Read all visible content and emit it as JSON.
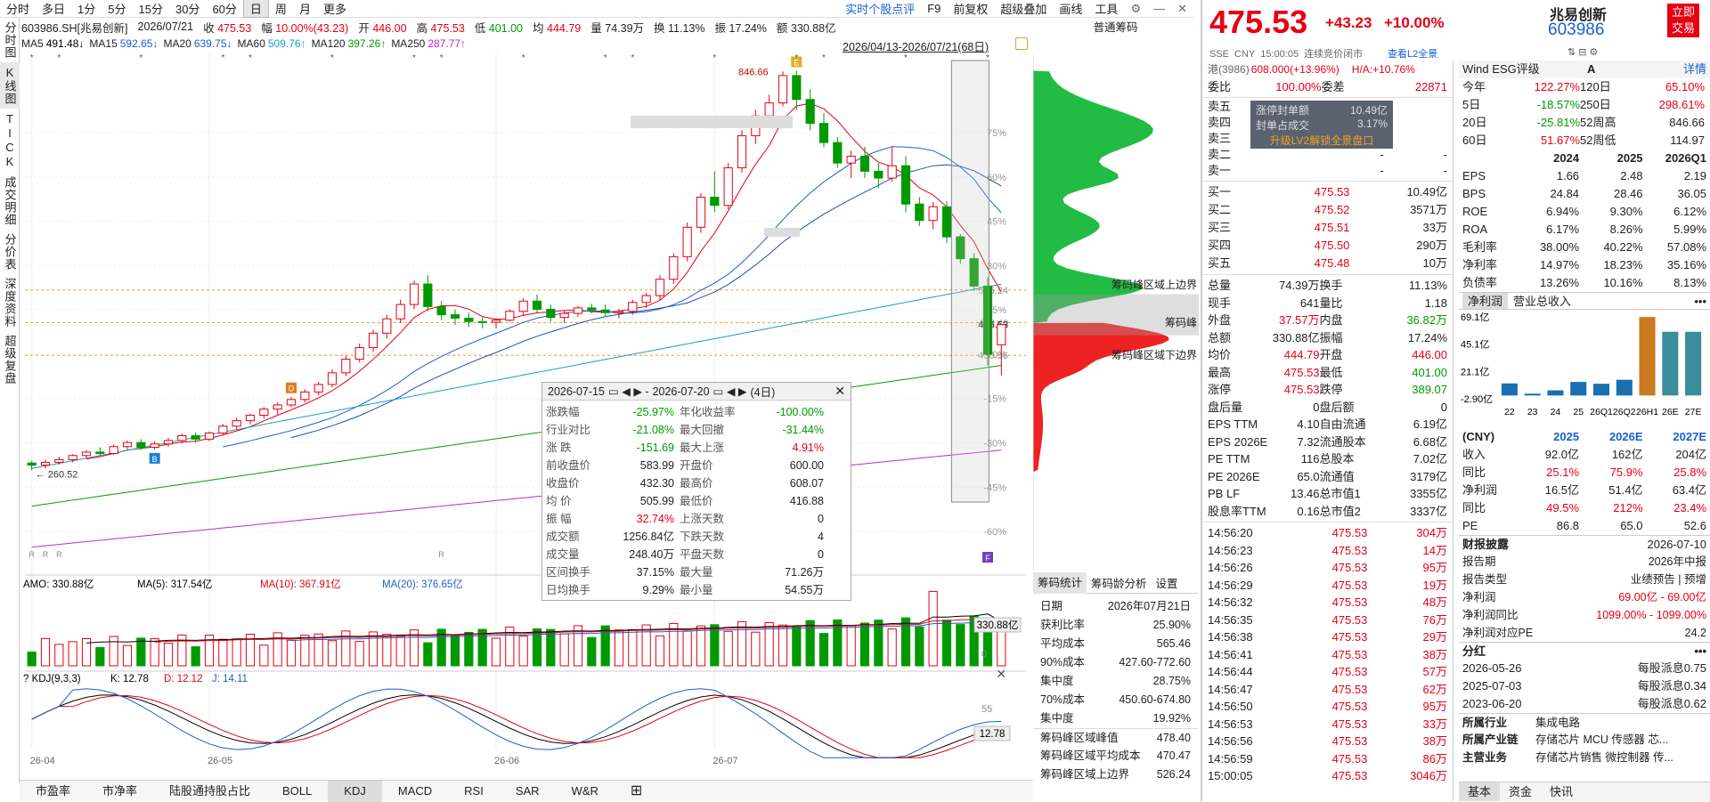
{
  "toolbar": {
    "periods": [
      "分时",
      "多日",
      "1分",
      "5分",
      "15分",
      "30分",
      "60分",
      "日",
      "周",
      "月",
      "更多"
    ],
    "selected": "日",
    "right_items": [
      "实时个股点评",
      "F9",
      "前复权",
      "超级叠加",
      "画线",
      "工具"
    ],
    "icons": [
      "gear-icon",
      "minus-icon",
      "close-icon"
    ]
  },
  "info": {
    "code": "603986.SH[兆易创新]",
    "date": "2026/07/21",
    "close_label": "收",
    "close": "475.53",
    "chg_label": "幅",
    "chg": "10.00%(43.23)",
    "open_label": "开",
    "open": "446.00",
    "high_label": "高",
    "high": "475.53",
    "low_label": "低",
    "low": "401.00",
    "avg_label": "均",
    "avg": "444.79",
    "vol_label": "量",
    "vol": "74.39万",
    "turn_label": "换",
    "turn": "11.13%",
    "amp_label": "振",
    "amp": "17.24%",
    "amt_label": "额",
    "amt": "330.88亿"
  },
  "ma": [
    {
      "name": "MA5",
      "value": "491.48↓",
      "color": "#000000"
    },
    {
      "name": "MA15",
      "value": "592.65↓",
      "color": "#1a5fd0"
    },
    {
      "name": "MA20",
      "value": "639.75↓",
      "color": "#1a5fd0"
    },
    {
      "name": "MA60",
      "value": "509.76↑",
      "color": "#19a0c8"
    },
    {
      "name": "MA120",
      "value": "397.26↑",
      "color": "#009a00"
    },
    {
      "name": "MA250",
      "value": "287.77↑",
      "color": "#cc22cc"
    }
  ],
  "range_text": "2026/04/13-2026/07/21(68日)",
  "vtabs": [
    "分时图",
    "K线图",
    "TICK",
    "成交明细",
    "分价表",
    "深度资料",
    "超级复盘"
  ],
  "kchart": {
    "pct_ticks": [
      "75%",
      "60%",
      "45%",
      "30%",
      "15%",
      "0%",
      "-15%",
      "-30%",
      "-45%",
      "-60%"
    ],
    "high_marker": "846.66",
    "low_marker": "260.52",
    "price_marks": [
      "526.24",
      "478.40",
      "475.53",
      "430.56"
    ],
    "date_ticks": [
      "26-04",
      "26-05",
      "26-06",
      "26-07"
    ],
    "event_badges": [
      "D",
      "E",
      "F",
      "B"
    ],
    "rights_marker": "R"
  },
  "amo": {
    "label": "AMO: 330.88亿",
    "ma5": "MA(5): 317.54亿",
    "ma10": "MA(10): 367.91亿",
    "ma20": "MA(20): 376.65亿",
    "last": "330.88亿",
    "zero": "0"
  },
  "kdj": {
    "label": "KDJ(9,3,3)",
    "k": "K: 12.78",
    "d": "D: 12.12",
    "j": "J: 14.11",
    "tick": "55",
    "last": "12.78"
  },
  "bottom_tabs": [
    "市盈率",
    "市净率",
    "陆股通持股占比",
    "BOLL",
    "KDJ",
    "MACD",
    "RSI",
    "SAR",
    "W&R"
  ],
  "bottom_active": "KDJ",
  "popup": {
    "from": "2026-07-15",
    "to": "2026-07-20",
    "days": "(4日)",
    "rows": [
      [
        "涨跌幅",
        "-25.97%",
        "年化收益率",
        "-100.00%"
      ],
      [
        "行业对比",
        "-21.08%",
        "最大回撤",
        "-31.44%"
      ],
      [
        "涨 跌",
        "-151.69",
        "最大上涨",
        "4.91%"
      ],
      [
        "前收盘价",
        "583.99",
        "开盘价",
        "600.00"
      ],
      [
        "收盘价",
        "432.30",
        "最高价",
        "608.07"
      ],
      [
        "均 价",
        "505.99",
        "最低价",
        "416.88"
      ],
      [
        "振 幅",
        "32.74%",
        "上涨天数",
        "0"
      ],
      [
        "成交额",
        "1256.84亿",
        "下跌天数",
        "4"
      ],
      [
        "成交量",
        "248.40万",
        "平盘天数",
        "0"
      ],
      [
        "区间换手",
        "37.15%",
        "最大量",
        "71.26万"
      ],
      [
        "日均换手",
        "9.29%",
        "最小量",
        "54.55万"
      ]
    ]
  },
  "chips": {
    "title": "普通筹码",
    "labels": [
      "筹码峰区域上边界",
      "筹码峰",
      "筹码峰区域下边界"
    ],
    "tabs": [
      "筹码统计",
      "筹码龄分析",
      "设置"
    ],
    "stats": [
      [
        "日期",
        "2026年07月21日"
      ],
      [
        "获利比率",
        "25.90%"
      ],
      [
        "平均成本",
        "565.46"
      ],
      [
        "90%成本",
        "427.60-772.60"
      ],
      [
        "集中度",
        "28.75%"
      ],
      [
        "70%成本",
        "450.60-674.80"
      ],
      [
        "集中度",
        "19.92%"
      ],
      [
        "筹码峰区域峰值",
        "478.40"
      ],
      [
        "筹码峰区域平均成本",
        "470.47"
      ],
      [
        "筹码峰区域上边界",
        "526.24"
      ]
    ]
  },
  "quote": {
    "price": "475.53",
    "chg": "+43.23",
    "pct": "+10.00%",
    "name": "兆易创新",
    "code": "603986",
    "buy_btn": "立即交易",
    "sub": [
      "SSE",
      "CNY",
      "15:00:05",
      "连续竞价闭市"
    ],
    "l2": "查看L2全景",
    "hk": "港(3986)",
    "hk_val": "608.000(+13.96%)",
    "ha": "H/A:+10.76%",
    "ratio": [
      "委比",
      "100.00%",
      "委差",
      "22871"
    ],
    "asks": [
      [
        "卖五",
        "-",
        ""
      ],
      [
        "卖四",
        "-",
        ""
      ],
      [
        "卖三",
        "-",
        ""
      ],
      [
        "卖二",
        "-",
        "-"
      ],
      [
        "卖一",
        "-",
        "-"
      ]
    ],
    "limit": {
      "a": "涨停封单额",
      "av": "10.49亿",
      "b": "封单占成交",
      "bv": "3.17%",
      "c": "升级LV2解锁全景盘口"
    },
    "bids": [
      [
        "买一",
        "475.53",
        "10.49亿"
      ],
      [
        "买二",
        "475.52",
        "3571万"
      ],
      [
        "买三",
        "475.51",
        "33万"
      ],
      [
        "买四",
        "475.50",
        "290万"
      ],
      [
        "买五",
        "475.48",
        "10万"
      ]
    ],
    "stats": [
      [
        "总量",
        "74.39万",
        "换手",
        "11.13%"
      ],
      [
        "现手",
        "641",
        "量比",
        "1.18"
      ],
      [
        "外盘",
        "37.57万",
        "内盘",
        "36.82万"
      ],
      [
        "总额",
        "330.88亿",
        "振幅",
        "17.24%"
      ],
      [
        "均价",
        "444.79",
        "开盘",
        "446.00"
      ],
      [
        "最高",
        "475.53",
        "最低",
        "401.00"
      ],
      [
        "涨停",
        "475.53",
        "跌停",
        "389.07"
      ],
      [
        "盘后量",
        "0",
        "盘后额",
        "0"
      ],
      [
        "EPS TTM",
        "4.10",
        "自由流通",
        "6.19亿"
      ],
      [
        "EPS 2026E",
        "7.32",
        "流通股本",
        "6.68亿"
      ],
      [
        "PE TTM",
        "116",
        "总股本",
        "7.02亿"
      ],
      [
        "PE 2026E",
        "65.0",
        "流通值",
        "3179亿"
      ],
      [
        "PB LF",
        "13.46",
        "总市值1",
        "3355亿"
      ],
      [
        "股息率TTM",
        "0.16",
        "总市值2",
        "3337亿"
      ]
    ],
    "ticks": [
      [
        "14:56:20",
        "475.53",
        "304万"
      ],
      [
        "14:56:23",
        "475.53",
        "14万"
      ],
      [
        "14:56:26",
        "475.53",
        "95万"
      ],
      [
        "14:56:29",
        "475.53",
        "19万"
      ],
      [
        "14:56:32",
        "475.53",
        "48万"
      ],
      [
        "14:56:35",
        "475.53",
        "76万"
      ],
      [
        "14:56:38",
        "475.53",
        "29万"
      ],
      [
        "14:56:41",
        "475.53",
        "38万"
      ],
      [
        "14:56:44",
        "475.53",
        "57万"
      ],
      [
        "14:56:47",
        "475.53",
        "62万"
      ],
      [
        "14:56:50",
        "475.53",
        "95万"
      ],
      [
        "14:56:53",
        "475.53",
        "33万"
      ],
      [
        "14:56:56",
        "475.53",
        "38万"
      ],
      [
        "14:56:59",
        "475.53",
        "86万"
      ],
      [
        "15:00:05",
        "475.53",
        "3046万"
      ]
    ]
  },
  "fund": {
    "wind": "Wind ESG评级",
    "grade": "A",
    "detail": "详情",
    "perf": [
      [
        "今年",
        "122.27%",
        "120日",
        "65.10%"
      ],
      [
        "5日",
        "-18.57%",
        "250日",
        "298.61%"
      ],
      [
        "20日",
        "-25.81%",
        "52周高",
        "846.66"
      ],
      [
        "60日",
        "51.67%",
        "52周低",
        "114.97"
      ]
    ],
    "years": [
      "2024",
      "2025",
      "2026Q1"
    ],
    "metrics": [
      [
        "EPS",
        "1.66",
        "2.48",
        "2.19"
      ],
      [
        "BPS",
        "24.84",
        "28.46",
        "36.05"
      ],
      [
        "ROE",
        "6.94%",
        "9.30%",
        "6.12%"
      ],
      [
        "ROA",
        "6.17%",
        "8.26%",
        "5.99%"
      ],
      [
        "毛利率",
        "38.00%",
        "40.22%",
        "57.08%"
      ],
      [
        "净利率",
        "14.97%",
        "18.23%",
        "35.16%"
      ],
      [
        "负债率",
        "13.26%",
        "10.16%",
        "8.13%"
      ]
    ],
    "tabs": [
      "净利润",
      "营业总收入"
    ],
    "chart": {
      "yticks": [
        "69.1亿",
        "45.1亿",
        "21.1亿",
        "-2.90亿"
      ],
      "xticks": [
        "22",
        "23",
        "24",
        "25",
        "26Q1",
        "26Q2",
        "26H1",
        "26E",
        "27E"
      ],
      "values": [
        10.6,
        1.6,
        4.5,
        11.9,
        10.3,
        13.8,
        69.0,
        56.0,
        56.0
      ]
    },
    "est_head": [
      "(CNY)",
      "2025",
      "2026E",
      "2027E"
    ],
    "est": [
      [
        "收入",
        "92.0亿",
        "162亿",
        "204亿"
      ],
      [
        "同比",
        "25.1%",
        "75.9%",
        "25.8%"
      ],
      [
        "净利润",
        "16.5亿",
        "51.4亿",
        "63.4亿"
      ],
      [
        "同比",
        "49.5%",
        "212%",
        "23.4%"
      ],
      [
        "PE",
        "86.8",
        "65.0",
        "52.6"
      ]
    ],
    "report": {
      "title": "财报披露",
      "date": "2026-07-10",
      "r1": [
        "报告期",
        "2026年中报"
      ],
      "r2": [
        "报告类型",
        "业绩预告 | 预增"
      ],
      "r3": [
        "净利润",
        "69.00亿 - 69.00亿"
      ],
      "r4": [
        "净利润同比",
        "1099.00% - 1099.00%"
      ],
      "r5": [
        "净利润对应PE",
        "24.2"
      ]
    },
    "div": {
      "title": "分红",
      "rows": [
        [
          "2026-05-26",
          "每股派息0.75"
        ],
        [
          "2025-07-03",
          "每股派息0.34"
        ],
        [
          "2023-06-20",
          "每股派息0.62"
        ]
      ]
    },
    "industry": [
      [
        "所属行业",
        "集成电路"
      ],
      [
        "所属产业链",
        "存储芯片  MCU  传感器  芯..."
      ],
      [
        "主营业务",
        "存储芯片销售  微控制器  传..."
      ]
    ],
    "bottom": [
      "基本",
      "资金",
      "快讯"
    ]
  },
  "candles": [
    [
      273,
      276,
      262,
      270
    ],
    [
      270,
      278,
      265,
      274
    ],
    [
      274,
      282,
      271,
      278
    ],
    [
      278,
      286,
      274,
      284
    ],
    [
      284,
      292,
      280,
      289
    ],
    [
      289,
      296,
      284,
      287
    ],
    [
      287,
      300,
      285,
      297
    ],
    [
      297,
      306,
      293,
      303
    ],
    [
      303,
      308,
      292,
      296
    ],
    [
      296,
      305,
      293,
      301
    ],
    [
      301,
      310,
      297,
      306
    ],
    [
      306,
      316,
      302,
      313
    ],
    [
      313,
      318,
      303,
      308
    ],
    [
      308,
      319,
      305,
      317
    ],
    [
      317,
      330,
      314,
      327
    ],
    [
      327,
      339,
      322,
      335
    ],
    [
      335,
      345,
      330,
      343
    ],
    [
      343,
      355,
      338,
      352
    ],
    [
      352,
      362,
      344,
      358
    ],
    [
      358,
      370,
      355,
      366
    ],
    [
      366,
      381,
      362,
      377
    ],
    [
      377,
      392,
      372,
      388
    ],
    [
      388,
      410,
      384,
      405
    ],
    [
      405,
      430,
      400,
      425
    ],
    [
      425,
      448,
      420,
      442
    ],
    [
      442,
      468,
      436,
      463
    ],
    [
      463,
      490,
      455,
      484
    ],
    [
      484,
      512,
      478,
      505
    ],
    [
      505,
      540,
      498,
      535
    ],
    [
      535,
      548,
      495,
      502
    ],
    [
      502,
      510,
      482,
      490
    ],
    [
      490,
      498,
      475,
      485
    ],
    [
      485,
      493,
      472,
      480
    ],
    [
      480,
      486,
      470,
      479
    ],
    [
      479,
      485,
      470,
      482
    ],
    [
      482,
      498,
      480,
      495
    ],
    [
      495,
      514,
      488,
      510
    ],
    [
      510,
      520,
      492,
      498
    ],
    [
      498,
      505,
      480,
      486
    ],
    [
      486,
      496,
      478,
      492
    ],
    [
      492,
      503,
      487,
      500
    ],
    [
      500,
      506,
      492,
      497
    ],
    [
      497,
      505,
      488,
      493
    ],
    [
      493,
      499,
      485,
      495
    ],
    [
      495,
      512,
      490,
      508
    ],
    [
      508,
      522,
      500,
      518
    ],
    [
      518,
      548,
      512,
      542
    ],
    [
      542,
      580,
      535,
      575
    ],
    [
      575,
      625,
      568,
      618
    ],
    [
      618,
      668,
      610,
      662
    ],
    [
      662,
      700,
      640,
      650
    ],
    [
      650,
      712,
      645,
      705
    ],
    [
      705,
      760,
      698,
      752
    ],
    [
      752,
      790,
      740,
      781
    ],
    [
      781,
      812,
      770,
      800
    ],
    [
      800,
      846,
      795,
      840
    ],
    [
      840,
      847,
      790,
      805
    ],
    [
      805,
      820,
      760,
      770
    ],
    [
      770,
      785,
      735,
      742
    ],
    [
      742,
      750,
      705,
      712
    ],
    [
      712,
      730,
      690,
      722
    ],
    [
      722,
      736,
      690,
      700
    ],
    [
      700,
      712,
      675,
      690
    ],
    [
      690,
      735,
      685,
      708
    ],
    [
      708,
      722,
      640,
      652
    ],
    [
      652,
      662,
      620,
      628
    ],
    [
      628,
      655,
      615,
      648
    ],
    [
      648,
      656,
      595,
      604
    ],
    [
      604,
      608,
      565,
      572
    ],
    [
      572,
      580,
      525,
      532
    ],
    [
      532,
      545,
      416,
      432
    ],
    [
      446,
      475.53,
      401,
      475.53
    ]
  ]
}
